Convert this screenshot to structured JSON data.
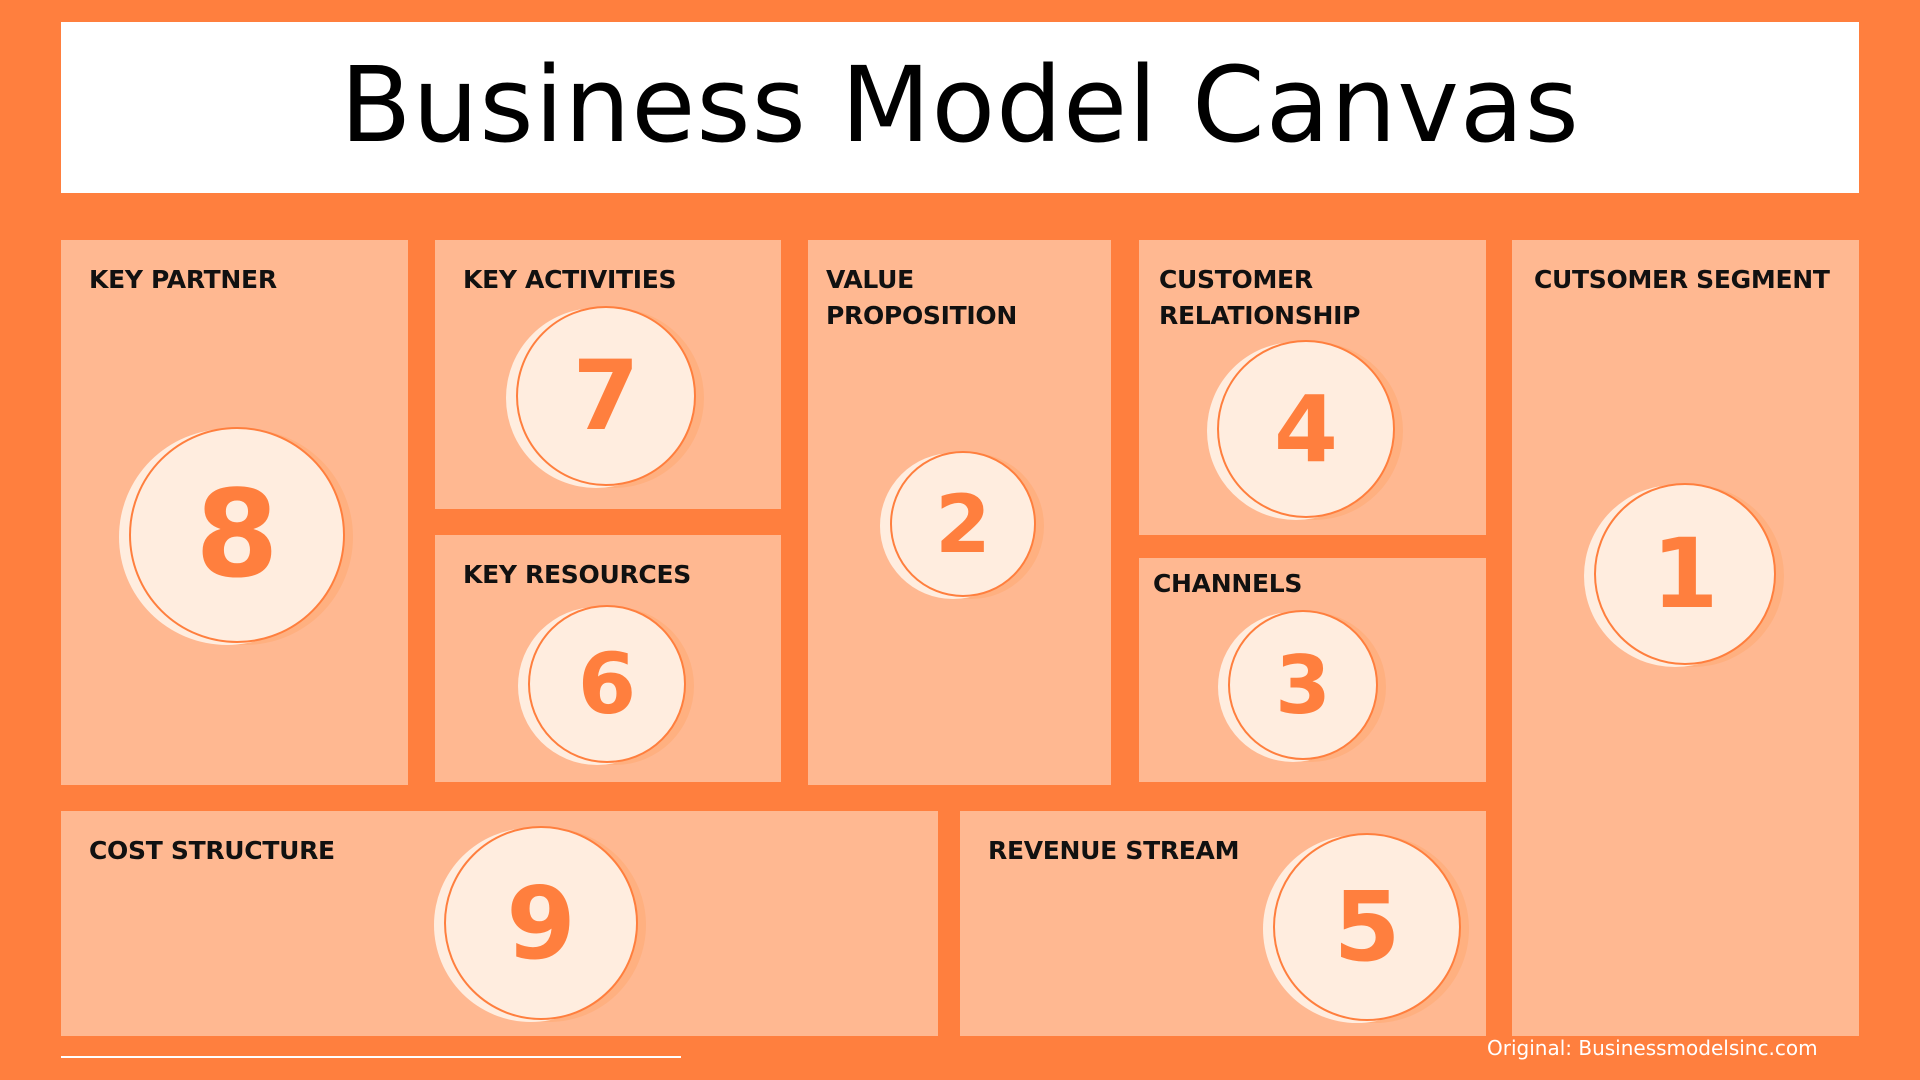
{
  "title": "Business Model Canvas",
  "colors": {
    "background": "#FF7F3E",
    "panel": "#FFB891",
    "circle": "#FFEDDF",
    "number": "#FF7F3E",
    "title_box": "#FFFFFF"
  },
  "blocks": {
    "key_partner": {
      "label": "KEY PARTNER",
      "number": "8"
    },
    "key_activities": {
      "label": "KEY ACTIVITIES",
      "number": "7"
    },
    "key_resources": {
      "label": "KEY RESOURCES",
      "number": "6"
    },
    "value_proposition": {
      "label": "VALUE PROPOSITION",
      "number": "2"
    },
    "customer_relationship": {
      "label_line1": "CUSTOMER",
      "label_line2": "RELATIONSHIP",
      "number": "4"
    },
    "channels": {
      "label": "CHANNELS",
      "number": "3"
    },
    "customer_segment": {
      "label": "CUTSOMER SEGMENT",
      "number": "1"
    },
    "cost_structure": {
      "label": "COST STRUCTURE",
      "number": "9"
    },
    "revenue_stream": {
      "label": "REVENUE STREAM",
      "number": "5"
    }
  },
  "attribution": "Original: Businessmodelsinc.com"
}
